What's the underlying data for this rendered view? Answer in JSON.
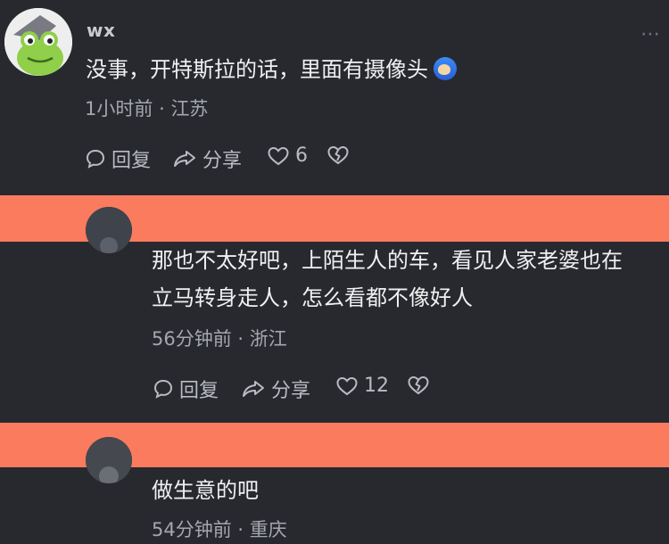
{
  "comments": [
    {
      "username": "wx",
      "text": "没事，开特斯拉的话，里面有摄像头",
      "emoji": "emoji-icon",
      "time": "1小时前",
      "location": "江苏",
      "reply_label": "回复",
      "share_label": "分享",
      "like_count": "6"
    },
    {
      "text_line1": "那也不太好吧，上陌生人的车，看见人家老婆也在",
      "text_line2": "立马转身走人，怎么看都不像好人",
      "time": "56分钟前",
      "location": "浙江",
      "reply_label": "回复",
      "share_label": "分享",
      "like_count": "12"
    },
    {
      "text": "做生意的吧",
      "time": "54分钟前",
      "location": "重庆"
    }
  ],
  "separator": "·",
  "more_icon": "⋯",
  "colors": {
    "background": "#27292e",
    "banner": "#fb7b5f"
  }
}
